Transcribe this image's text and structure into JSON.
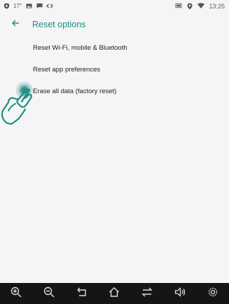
{
  "status_bar": {
    "temperature": "17°",
    "time": "13:25",
    "icons_left": [
      "shield-icon",
      "image-icon",
      "message-icon",
      "code-icon"
    ],
    "icons_right": [
      "screen-icon",
      "location-icon",
      "wifi-icon"
    ]
  },
  "app_bar": {
    "title": "Reset options",
    "back_icon": "arrow-left-icon"
  },
  "options": [
    {
      "label": "Reset Wi-Fi, mobile & Bluetooth"
    },
    {
      "label": "Reset app preferences"
    },
    {
      "label": "Erase all data (factory reset)"
    }
  ],
  "pointer": {
    "target": "Erase all data (factory reset)"
  },
  "nav_bar": {
    "buttons": [
      "zoom-in-icon",
      "zoom-out-icon",
      "back-icon",
      "home-icon",
      "recent-apps-icon",
      "volume-icon",
      "settings-icon"
    ]
  },
  "colors": {
    "accent": "#1e8e84",
    "text": "#222222",
    "nav_background": "#151515",
    "background": "#f5f5f5"
  }
}
